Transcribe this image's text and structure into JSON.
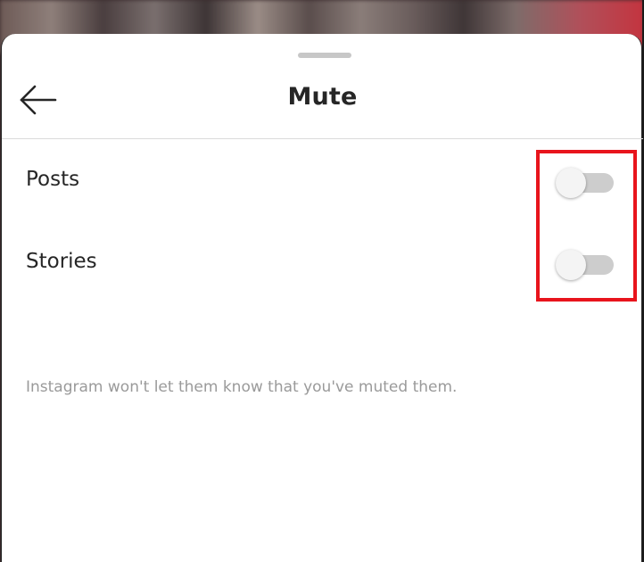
{
  "header": {
    "title": "Mute",
    "back_icon": "arrow-left-icon"
  },
  "settings": {
    "posts": {
      "label": "Posts",
      "enabled": false
    },
    "stories": {
      "label": "Stories",
      "enabled": false
    }
  },
  "footnote": "Instagram won't let them know that you've muted them.",
  "colors": {
    "highlight": "#e8141c",
    "toggle_track": "#cdcdcd",
    "footnote_text": "#9a9a9a"
  }
}
